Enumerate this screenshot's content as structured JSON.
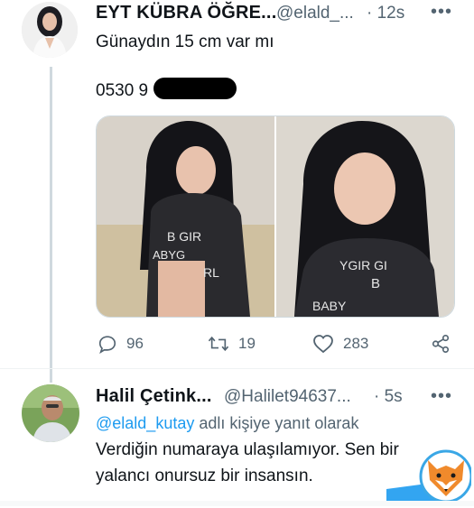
{
  "tweet1": {
    "name": "EYT KÜBRA ÖĞRE...",
    "handle": "@elald_...",
    "time": "· 12s",
    "more": "•••",
    "text": "Günaydın 15 cm var mı",
    "phone": "0530 9",
    "stats": {
      "replies": "96",
      "retweets": "19",
      "likes": "283"
    }
  },
  "tweet2": {
    "name": "Halil Çetink...",
    "handle": "@Halilet94637...",
    "time": "· 5s",
    "more": "•••",
    "reply_mention": "@elald_kutay",
    "reply_suffix": "adlı kişiye yanıt olarak",
    "text_line1": "Verdiğin numaraya ulaşılamıyor. Sen bir",
    "text_line2": "yalancı onursuz bir insansın."
  },
  "colors": {
    "text": "#0f1419",
    "muted": "#536471",
    "accent": "#1d9bf0",
    "divider": "#cfd9de"
  }
}
